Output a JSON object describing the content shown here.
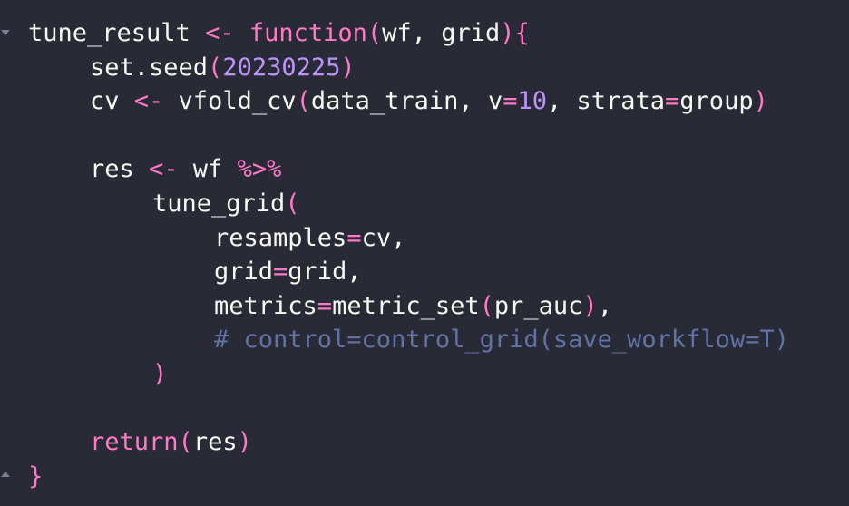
{
  "editor": {
    "language": "R",
    "theme_colors": {
      "background": "#282a36",
      "text": "#f8f8f2",
      "keyword": "#ff79c6",
      "number": "#bd93f9",
      "comment": "#6272a4",
      "fold_marker": "#7c7f93"
    },
    "fold_markers": {
      "open_icon": "fold-open-triangle",
      "close_icon": "fold-close-triangle"
    },
    "lines": [
      {
        "indent": 0,
        "fold": "down",
        "tokens": [
          {
            "t": "tune_result ",
            "k": "plain"
          },
          {
            "t": "<-",
            "k": "op"
          },
          {
            "t": " ",
            "k": "plain"
          },
          {
            "t": "function",
            "k": "kw"
          },
          {
            "t": "(",
            "k": "paren"
          },
          {
            "t": "wf, grid",
            "k": "plain"
          },
          {
            "t": "){",
            "k": "paren"
          }
        ]
      },
      {
        "indent": 4,
        "tokens": [
          {
            "t": "set.seed",
            "k": "plain"
          },
          {
            "t": "(",
            "k": "paren"
          },
          {
            "t": "20230225",
            "k": "num"
          },
          {
            "t": ")",
            "k": "paren"
          }
        ]
      },
      {
        "indent": 4,
        "tokens": [
          {
            "t": "cv ",
            "k": "plain"
          },
          {
            "t": "<-",
            "k": "op"
          },
          {
            "t": " vfold_cv",
            "k": "plain"
          },
          {
            "t": "(",
            "k": "paren"
          },
          {
            "t": "data_train, v",
            "k": "plain"
          },
          {
            "t": "=",
            "k": "op"
          },
          {
            "t": "10",
            "k": "num"
          },
          {
            "t": ", strata",
            "k": "plain"
          },
          {
            "t": "=",
            "k": "op"
          },
          {
            "t": "group",
            "k": "plain"
          },
          {
            "t": ")",
            "k": "paren"
          }
        ]
      },
      {
        "indent": 0,
        "tokens": []
      },
      {
        "indent": 4,
        "tokens": [
          {
            "t": "res ",
            "k": "plain"
          },
          {
            "t": "<-",
            "k": "op"
          },
          {
            "t": " wf ",
            "k": "plain"
          },
          {
            "t": "%>%",
            "k": "op"
          }
        ]
      },
      {
        "indent": 8,
        "tokens": [
          {
            "t": "tune_grid",
            "k": "plain"
          },
          {
            "t": "(",
            "k": "paren"
          }
        ]
      },
      {
        "indent": 12,
        "tokens": [
          {
            "t": "resamples",
            "k": "plain"
          },
          {
            "t": "=",
            "k": "op"
          },
          {
            "t": "cv,",
            "k": "plain"
          }
        ]
      },
      {
        "indent": 12,
        "tokens": [
          {
            "t": "grid",
            "k": "plain"
          },
          {
            "t": "=",
            "k": "op"
          },
          {
            "t": "grid,",
            "k": "plain"
          }
        ]
      },
      {
        "indent": 12,
        "tokens": [
          {
            "t": "metrics",
            "k": "plain"
          },
          {
            "t": "=",
            "k": "op"
          },
          {
            "t": "metric_set",
            "k": "plain"
          },
          {
            "t": "(",
            "k": "paren"
          },
          {
            "t": "pr_auc",
            "k": "plain"
          },
          {
            "t": ")",
            "k": "paren"
          },
          {
            "t": ",",
            "k": "plain"
          }
        ]
      },
      {
        "indent": 12,
        "tokens": [
          {
            "t": "# control=control_grid(save_workflow=T)",
            "k": "comment"
          }
        ]
      },
      {
        "indent": 8,
        "tokens": [
          {
            "t": ")",
            "k": "paren"
          }
        ]
      },
      {
        "indent": 0,
        "tokens": []
      },
      {
        "indent": 4,
        "tokens": [
          {
            "t": "return",
            "k": "kw"
          },
          {
            "t": "(",
            "k": "paren"
          },
          {
            "t": "res",
            "k": "plain"
          },
          {
            "t": ")",
            "k": "paren"
          }
        ]
      },
      {
        "indent": 0,
        "fold": "up",
        "tokens": [
          {
            "t": "}",
            "k": "paren"
          }
        ]
      }
    ]
  }
}
